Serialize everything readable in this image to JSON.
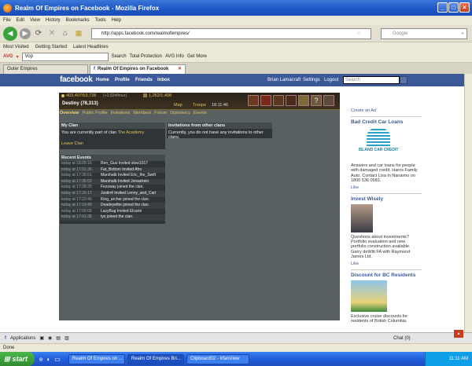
{
  "window": {
    "title": "Realm Of Empires on Facebook - Mozilla Firefox"
  },
  "menu": [
    "File",
    "Edit",
    "View",
    "History",
    "Bookmarks",
    "Tools",
    "Help"
  ],
  "nav": {
    "url": "http://apps.facebook.com/realmofempires/",
    "search_placeholder": "Google"
  },
  "bookmarks": [
    "Most Visited",
    "Getting Started",
    "Latest Headlines"
  ],
  "avg": {
    "label": "AVG",
    "search_value": "Vop",
    "search_btn": "Search",
    "total_protection": "Total Protection",
    "avg_info": "AVG Info",
    "get_more": "Get More"
  },
  "tabs": [
    {
      "label": "Outer Empires"
    },
    {
      "label": "Realm Of Empires on Facebook"
    }
  ],
  "fb": {
    "logo": "facebook",
    "nav": [
      "Home",
      "Profile",
      "Friends",
      "Inbox"
    ],
    "user": "Brian Lamacraft",
    "settings": "Settings",
    "logout": "Logout",
    "search_placeholder": "Search"
  },
  "game": {
    "coins": "403,407/53,728",
    "coins_suffix": "(+2,024/hour)",
    "food": "1,262/1,408",
    "village": "Destiny (78,313)",
    "map": "Map",
    "troops": "Troops",
    "clock": "18:11:46",
    "tabs": [
      "Overview",
      "Public Profile",
      "Invitations",
      "Members",
      "Forum",
      "Diplomacy",
      "Events"
    ],
    "my_clan": {
      "title": "My Clan",
      "text_prefix": "You are currently part of clan",
      "clan_name": "The Academy",
      "leave": "Leave Clan"
    },
    "invitations": {
      "title": "Invitations from other clans",
      "text": "Currently, you do not have any invitations to other clans."
    },
    "events": {
      "title": "Recent Events",
      "rows": [
        {
          "time": "today at 18:05:16",
          "text": "Ren_Guo Invited slow1017"
        },
        {
          "time": "today at 17:51:36",
          "text": "Fat_Bottom Invited Afro"
        },
        {
          "time": "today at 17:36:51",
          "text": "Marshalb Invited Eric_the_Swift"
        },
        {
          "time": "today at 17:35:52",
          "text": "Marshalb Invited Jonastrein"
        },
        {
          "time": "today at 17:28:25",
          "text": "Fezzway joined the clan."
        },
        {
          "time": "today at 17:26:17",
          "text": "Justin4 Invited Lenny_and_Carl"
        },
        {
          "time": "today at 17:22:40",
          "text": "King_archer joined the clan."
        },
        {
          "time": "today at 17:19:49",
          "text": "Deadeyethe joined the clan."
        },
        {
          "time": "today at 17:05:05",
          "text": "LazyBug Invited Elcarin"
        },
        {
          "time": "today at 17:01:38",
          "text": "tys joined the clan."
        }
      ]
    }
  },
  "ads": {
    "create": "Create an Ad",
    "items": [
      {
        "title": "Bad Credit Car Loans",
        "logo": "ISLAND CAR CREDIT",
        "text": "Answers and car loans for people with damaged credit. Harris Family Auto. Contact Lisa in Nanaimo on 1800 536 0583.",
        "like": "Like"
      },
      {
        "title": "Invest Wisely",
        "text": "Questions about investments? Portfolio evaluation and new portfolio construction available. Garry deWitt FA with Raymond James Ltd.",
        "like": "Like"
      },
      {
        "title": "Discount for BC Residents",
        "text": "Exclusive cruise discounts for residents of British Columbia.",
        "like": "Like"
      }
    ]
  },
  "fbchat": {
    "apps": "Applications",
    "chat": "Chat (0)"
  },
  "status": "Done",
  "taskbar": {
    "start": "start",
    "items": [
      "Realm Of Empires on ...",
      "Realm Of Empires Bri...",
      "Clipboard02 - IrfanView"
    ],
    "clock": "11:11 AM"
  }
}
